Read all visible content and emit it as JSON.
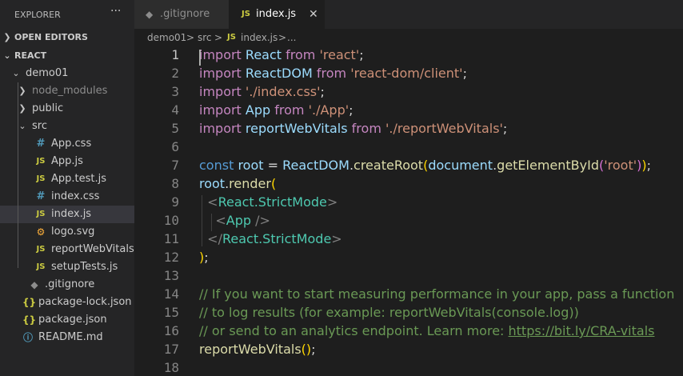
{
  "explorer": {
    "title": "EXPLORER",
    "more_icon": "ellipsis-icon",
    "sections": {
      "open_editors": "OPEN EDITORS",
      "workspace": "REACT"
    },
    "tree": [
      {
        "label": "demo01",
        "type": "folder",
        "expanded": true
      },
      {
        "label": "node_modules",
        "type": "folder",
        "expanded": false
      },
      {
        "label": "public",
        "type": "folder",
        "expanded": false
      },
      {
        "label": "src",
        "type": "folder",
        "expanded": true
      },
      {
        "label": "App.css",
        "type": "css",
        "icon": "#"
      },
      {
        "label": "App.js",
        "type": "js",
        "icon": "JS"
      },
      {
        "label": "App.test.js",
        "type": "js",
        "icon": "JS"
      },
      {
        "label": "index.css",
        "type": "css",
        "icon": "#"
      },
      {
        "label": "index.js",
        "type": "js",
        "icon": "JS",
        "selected": true
      },
      {
        "label": "logo.svg",
        "type": "svg",
        "icon": "⚙"
      },
      {
        "label": "reportWebVitals.js",
        "type": "js",
        "icon": "JS"
      },
      {
        "label": "setupTests.js",
        "type": "js",
        "icon": "JS"
      },
      {
        "label": ".gitignore",
        "type": "git",
        "icon": "◆"
      },
      {
        "label": "package-lock.json",
        "type": "json",
        "icon": "{}"
      },
      {
        "label": "package.json",
        "type": "json",
        "icon": "{}"
      },
      {
        "label": "README.md",
        "type": "info",
        "icon": "ⓘ"
      }
    ]
  },
  "tabs": [
    {
      "label": ".gitignore",
      "icon": "◆",
      "active": false
    },
    {
      "label": "index.js",
      "icon": "JS",
      "active": true,
      "close": "✕"
    }
  ],
  "breadcrumb": {
    "parts": [
      "demo01",
      "src",
      "index.js",
      "..."
    ],
    "sep": ">",
    "file_icon": "JS"
  },
  "editor": {
    "line_numbers": [
      "1",
      "2",
      "3",
      "4",
      "5",
      "6",
      "7",
      "8",
      "9",
      "10",
      "11",
      "12",
      "13",
      "14",
      "15",
      "16",
      "17",
      "18"
    ],
    "lines": [
      [
        [
          "kw",
          "import"
        ],
        [
          "t",
          " "
        ],
        [
          "id",
          "React"
        ],
        [
          "t",
          " "
        ],
        [
          "kw",
          "from"
        ],
        [
          "t",
          " "
        ],
        [
          "str",
          "'react'"
        ],
        [
          "t",
          ";"
        ]
      ],
      [
        [
          "kw",
          "import"
        ],
        [
          "t",
          " "
        ],
        [
          "id",
          "ReactDOM"
        ],
        [
          "t",
          " "
        ],
        [
          "kw",
          "from"
        ],
        [
          "t",
          " "
        ],
        [
          "str",
          "'react-dom/client'"
        ],
        [
          "t",
          ";"
        ]
      ],
      [
        [
          "kw",
          "import"
        ],
        [
          "t",
          " "
        ],
        [
          "str",
          "'./index.css'"
        ],
        [
          "t",
          ";"
        ]
      ],
      [
        [
          "kw",
          "import"
        ],
        [
          "t",
          " "
        ],
        [
          "id",
          "App"
        ],
        [
          "t",
          " "
        ],
        [
          "kw",
          "from"
        ],
        [
          "t",
          " "
        ],
        [
          "str",
          "'./App'"
        ],
        [
          "t",
          ";"
        ]
      ],
      [
        [
          "kw",
          "import"
        ],
        [
          "t",
          " "
        ],
        [
          "id",
          "reportWebVitals"
        ],
        [
          "t",
          " "
        ],
        [
          "kw",
          "from"
        ],
        [
          "t",
          " "
        ],
        [
          "str",
          "'./reportWebVitals'"
        ],
        [
          "t",
          ";"
        ]
      ],
      [],
      [
        [
          "kw2",
          "const"
        ],
        [
          "t",
          " "
        ],
        [
          "id",
          "root"
        ],
        [
          "t",
          " = "
        ],
        [
          "id",
          "ReactDOM"
        ],
        [
          "t",
          "."
        ],
        [
          "fn",
          "createRoot"
        ],
        [
          "p1",
          "("
        ],
        [
          "id",
          "document"
        ],
        [
          "t",
          "."
        ],
        [
          "fn",
          "getElementById"
        ],
        [
          "p2",
          "("
        ],
        [
          "str",
          "'root'"
        ],
        [
          "p2",
          ")"
        ],
        [
          "p1",
          ")"
        ],
        [
          "t",
          ";"
        ]
      ],
      [
        [
          "id",
          "root"
        ],
        [
          "t",
          "."
        ],
        [
          "fn",
          "render"
        ],
        [
          "p1",
          "("
        ]
      ],
      [
        [
          "t",
          "  "
        ],
        [
          "tag",
          "<"
        ],
        [
          "cls",
          "React.StrictMode"
        ],
        [
          "tag",
          ">"
        ]
      ],
      [
        [
          "t",
          "    "
        ],
        [
          "tag",
          "<"
        ],
        [
          "cls",
          "App"
        ],
        [
          "t",
          " "
        ],
        [
          "tag",
          "/>"
        ]
      ],
      [
        [
          "t",
          "  "
        ],
        [
          "tag",
          "</"
        ],
        [
          "cls",
          "React.StrictMode"
        ],
        [
          "tag",
          ">"
        ]
      ],
      [
        [
          "p1",
          ")"
        ],
        [
          "t",
          ";"
        ]
      ],
      [],
      [
        [
          "com",
          "// If you want to start measuring performance in your app, pass a function"
        ]
      ],
      [
        [
          "com",
          "// to log results (for example: reportWebVitals(console.log))"
        ]
      ],
      [
        [
          "com",
          "// or send to an analytics endpoint. Learn more: "
        ],
        [
          "com url",
          "https://bit.ly/CRA-vitals"
        ]
      ],
      [
        [
          "fn",
          "reportWebVitals"
        ],
        [
          "p1",
          "("
        ],
        [
          "p1",
          ")"
        ],
        [
          "t",
          ";"
        ]
      ],
      []
    ]
  }
}
